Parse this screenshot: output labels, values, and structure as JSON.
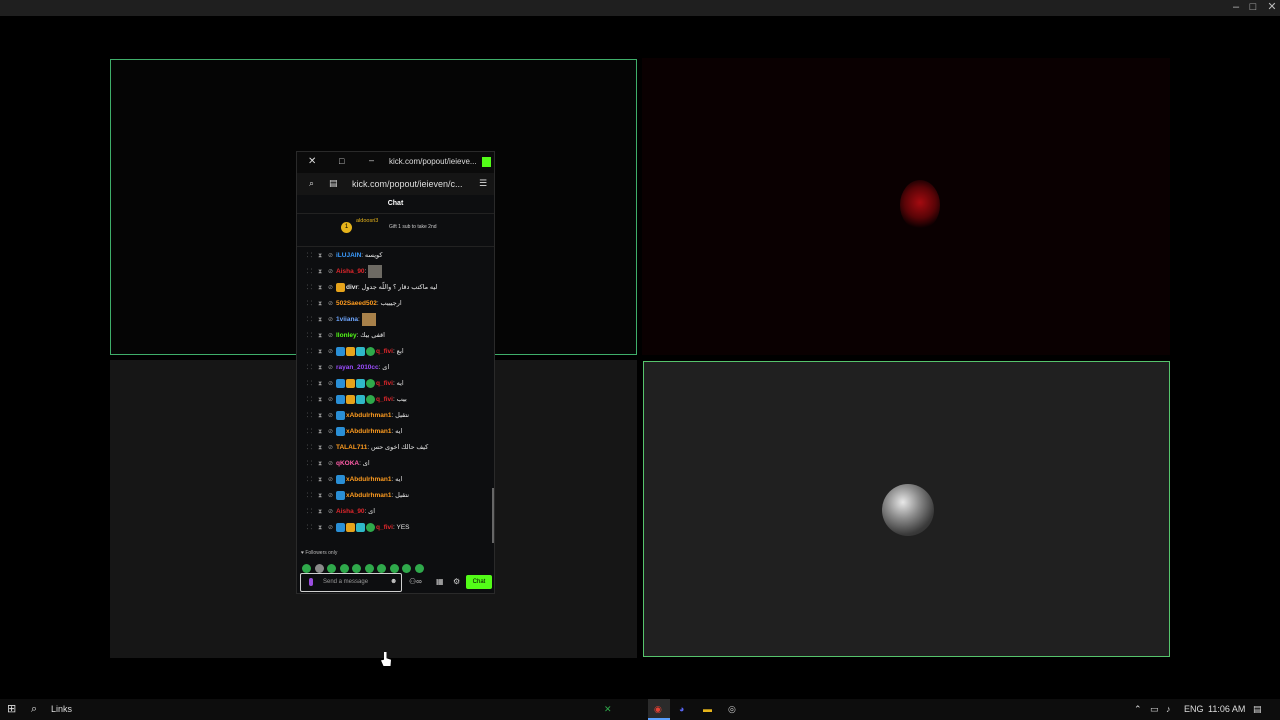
{
  "popup": {
    "title": "kick.com/popout/ieieve...",
    "url": "kick.com/popout/ieieven/c...",
    "header": "Chat",
    "pinned_user": "aldoosri3",
    "pinned_rank": "1",
    "pinned_note": "Gift 1 sub to take 2nd",
    "messages": [
      {
        "user": "iLUJAIN",
        "color": "#3b9cff",
        "text": "كويسه"
      },
      {
        "user": "Aisha_90",
        "color": "#e0262b",
        "text": ""
      },
      {
        "user": "divr",
        "color": "#e6e6e6",
        "text": "ليه ماكتب دقار ؟ واللّه جدول"
      },
      {
        "user": "502Saeed502",
        "color": "#ff9c1f",
        "text": "ارجيييب"
      },
      {
        "user": "1viiana",
        "color": "#6ea6ff",
        "text": ""
      },
      {
        "user": "llonley",
        "color": "#53fc18",
        "text": "اقفى بيك"
      },
      {
        "user": "q_fivi",
        "color": "#e0262b",
        "text": "ابع"
      },
      {
        "user": "rayan_2010cc",
        "color": "#9c4dff",
        "text": "اى"
      },
      {
        "user": "q_fivi",
        "color": "#e0262b",
        "text": "ايه"
      },
      {
        "user": "q_fivi",
        "color": "#e0262b",
        "text": "بيب"
      },
      {
        "user": "xAbdulrhman1",
        "color": "#ff9c1f",
        "text": "نتقيل"
      },
      {
        "user": "xAbdulrhman1",
        "color": "#ff9c1f",
        "text": "ايه"
      },
      {
        "user": "TALAL711",
        "color": "#ff9c1f",
        "text": "كيف حالك اخوى حس"
      },
      {
        "user": "qKOKA",
        "color": "#ff5ca8",
        "text": "اى"
      },
      {
        "user": "xAbdulrhman1",
        "color": "#ff9c1f",
        "text": "ايه"
      },
      {
        "user": "xAbdulrhman1",
        "color": "#ff9c1f",
        "text": "نتقيل"
      },
      {
        "user": "Aisha_90",
        "color": "#e0262b",
        "text": "اى"
      },
      {
        "user": "q_fivi",
        "color": "#e0262b",
        "text": "YES"
      }
    ],
    "followers_only": "Followers only",
    "input_placeholder": "Send a message",
    "send_label": "Chat"
  },
  "taskbar": {
    "search_label": "Links",
    "language": "ENG",
    "time": "11:06 AM"
  },
  "colors": {
    "accent_green": "#53fc18",
    "tile_border": "#3fae6a"
  }
}
